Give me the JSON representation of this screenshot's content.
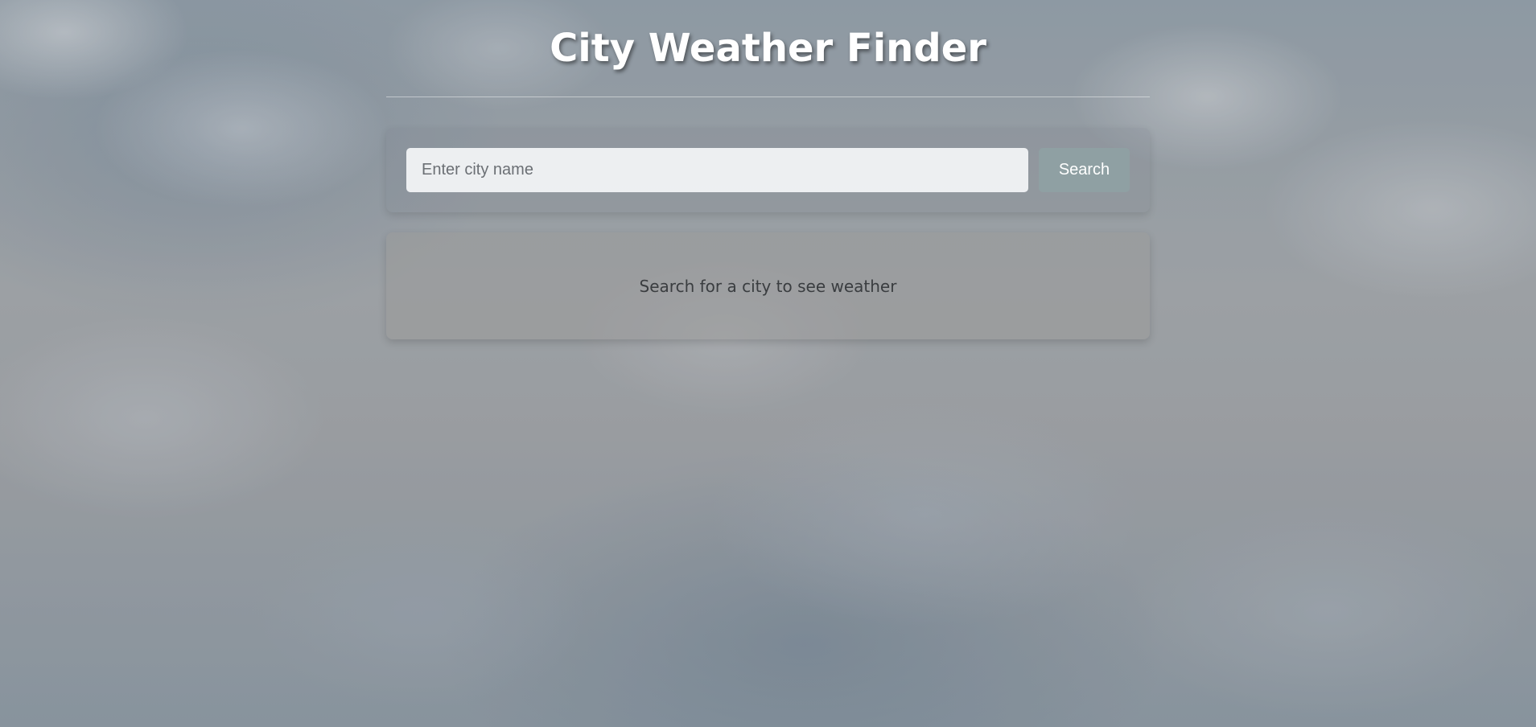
{
  "page": {
    "title": "City Weather Finder"
  },
  "search": {
    "placeholder": "Enter city name",
    "value": "",
    "button_label": "Search"
  },
  "result": {
    "message": "Search for a city to see weather"
  },
  "colors": {
    "title_text": "#ffffff",
    "button_bg": "#8fa0a3",
    "button_text": "#ffffff",
    "message_text": "#3a3d40"
  }
}
